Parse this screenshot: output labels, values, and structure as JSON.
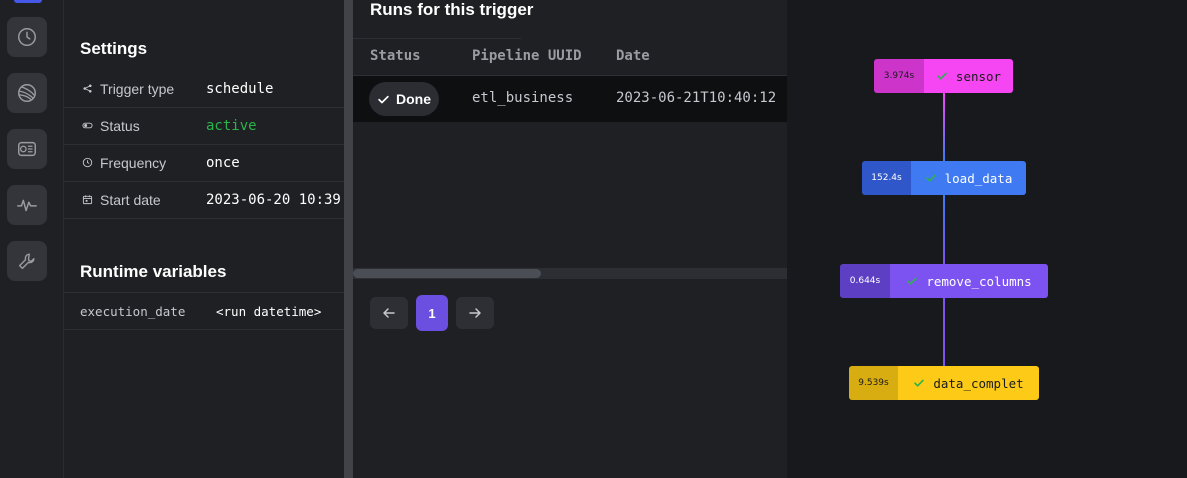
{
  "settings": {
    "title": "Settings",
    "rows": [
      {
        "label": "Trigger type",
        "value": "schedule"
      },
      {
        "label": "Status",
        "value": "active"
      },
      {
        "label": "Frequency",
        "value": "once"
      },
      {
        "label": "Start date",
        "value": "2023-06-20 10:39"
      }
    ]
  },
  "runtime": {
    "title": "Runtime variables",
    "variables": [
      {
        "key": "execution_date",
        "value": "<run datetime>"
      }
    ]
  },
  "runs": {
    "title": "Runs for this trigger",
    "columns": [
      "Status",
      "Pipeline UUID",
      "Date"
    ],
    "rows": [
      {
        "status": "Done",
        "pipeline_uuid": "etl_business",
        "date": "2023-06-21T10:40:12"
      }
    ]
  },
  "pagination": {
    "current_page": "1"
  },
  "graph": {
    "nodes": [
      {
        "name": "sensor",
        "duration": "3.974s",
        "color": "#f645f3",
        "dur_color": "#cc34ca",
        "text_color": "#1b1b1b",
        "check_color": "#2bb34a"
      },
      {
        "name": "load_data",
        "duration": "152.4s",
        "color": "#3f7af2",
        "dur_color": "#3057c9",
        "text_color": "#ffffff",
        "check_color": "#2bb34a"
      },
      {
        "name": "remove_columns",
        "duration": "0.644s",
        "color": "#7c53f0",
        "dur_color": "#5d3fc4",
        "text_color": "#ffffff",
        "check_color": "#2bb34a"
      },
      {
        "name": "data_complet",
        "duration": "9.539s",
        "color": "#fdcb17",
        "dur_color": "#d7ad12",
        "text_color": "#1b1b1b",
        "check_color": "#2bb34a"
      }
    ]
  }
}
